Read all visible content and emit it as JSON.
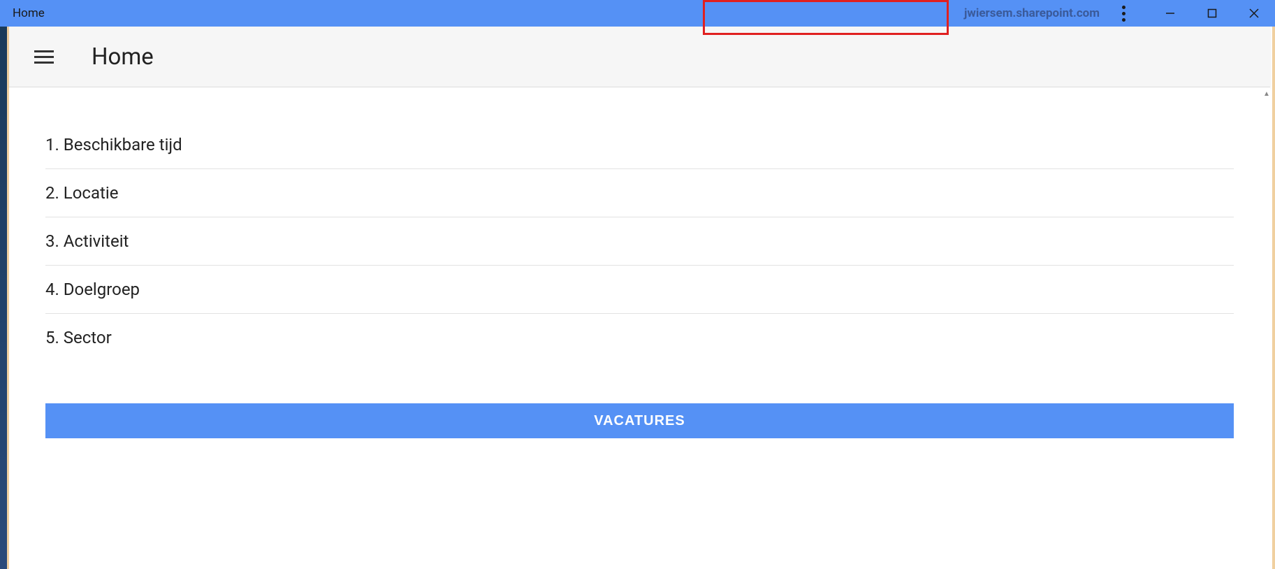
{
  "titlebar": {
    "title": "Home",
    "url": "jwiersem.sharepoint.com"
  },
  "appbar": {
    "title": "Home"
  },
  "list": {
    "items": [
      {
        "label": "1. Beschikbare tijd"
      },
      {
        "label": "2. Locatie"
      },
      {
        "label": "3. Activiteit"
      },
      {
        "label": "4. Doelgroep"
      },
      {
        "label": "5. Sector"
      }
    ]
  },
  "button": {
    "vacatures": "VACATURES"
  }
}
